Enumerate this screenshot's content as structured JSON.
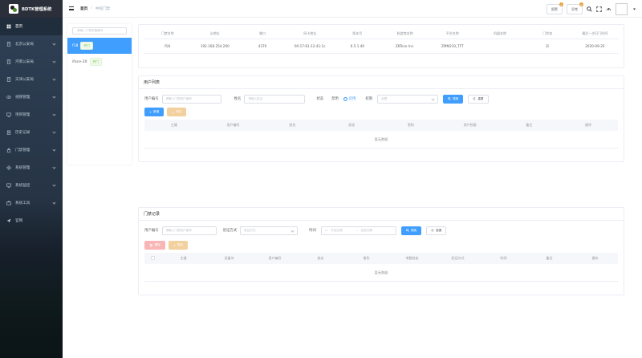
{
  "brand": {
    "title": "BDTK管理系统"
  },
  "sidebar": {
    "items": [
      {
        "label": "首页",
        "icon": "dashboard-icon",
        "arrow": false
      },
      {
        "label": "北京公安局",
        "icon": "building-icon",
        "arrow": true
      },
      {
        "label": "河南公安局",
        "icon": "building-icon",
        "arrow": true
      },
      {
        "label": "天津公安局",
        "icon": "building-icon",
        "arrow": true
      },
      {
        "label": "视频管理",
        "icon": "eye-icon",
        "arrow": true
      },
      {
        "label": "项目管理",
        "icon": "monitor-icon",
        "arrow": true
      },
      {
        "label": "历史记录",
        "icon": "clipboard-icon",
        "arrow": true
      },
      {
        "label": "门禁管理",
        "icon": "lock-icon",
        "arrow": true
      },
      {
        "label": "系统管理",
        "icon": "gear-icon",
        "arrow": true
      },
      {
        "label": "系统监控",
        "icon": "monitor-icon",
        "arrow": true
      },
      {
        "label": "系统工具",
        "icon": "tool-icon",
        "arrow": true
      },
      {
        "label": "官网",
        "icon": "send-icon",
        "arrow": false
      }
    ]
  },
  "topbar": {
    "breadcrumb_home": "首页",
    "breadcrumb_sep": "/",
    "breadcrumb_current": "中控门禁",
    "alarm_label": "报警",
    "alarm_badge": "1",
    "anomaly_label": "异常",
    "anomaly_badge": "0"
  },
  "devices": {
    "search_placeholder": "请输入门禁机器编号",
    "items": [
      {
        "name": "f18",
        "tag": "开门"
      },
      {
        "name": "iface-20",
        "tag": "开门"
      }
    ]
  },
  "device_info": {
    "columns": [
      "门禁名称",
      "ip地址",
      "端口",
      "网卡地址",
      "版本号",
      "制造商名称",
      "平台名称",
      "机器名称",
      "门状态",
      "最后一次开门时间"
    ],
    "rows": [
      [
        "f18",
        "192.168.254.200",
        "4370",
        "00:17:61:12:41:1c",
        "6.5.1.40",
        "ZKTeco Inc.",
        "ZMM210_TFT",
        "",
        "开",
        "2020-09-25"
      ]
    ]
  },
  "user_list": {
    "title": "用户列表",
    "user_no_label": "用户编号",
    "user_no_placeholder": "请输入门禁用户编号",
    "name_label": "姓名",
    "name_placeholder": "请输入姓名",
    "status_label": "状态",
    "status_disabled": "禁用",
    "status_enabled": "启用",
    "perm_label": "权限",
    "perm_placeholder": "权限",
    "search_btn": "搜索",
    "reset_btn": "重置",
    "add_btn": "新增",
    "export_btn": "导出",
    "columns": [
      "主键",
      "用户编号",
      "姓名",
      "状态",
      "密码",
      "用户权限",
      "备注",
      "操作"
    ],
    "empty_text": "暂无数据"
  },
  "access_log": {
    "title": "门禁记录",
    "user_no_label": "用户编号",
    "user_no_placeholder": "请输入门禁用户编号",
    "verify_label": "验证方式",
    "verify_placeholder": "验证方式",
    "time_label": "时间",
    "start_placeholder": "开始日期",
    "range_sep": "-",
    "end_placeholder": "结束日期",
    "search_btn": "搜索",
    "reset_btn": "重置",
    "delete_btn": "删除",
    "export_btn": "导出",
    "columns": [
      "主键",
      "设备id",
      "用户编号",
      "姓名",
      "角色",
      "考勤状态",
      "验证方式",
      "时间",
      "备注",
      "操作"
    ],
    "empty_text": "暂无数据"
  },
  "colors": {
    "primary": "#409eff",
    "sidebar": "#304156",
    "warning": "#e6a23c",
    "success": "#67c23a"
  }
}
